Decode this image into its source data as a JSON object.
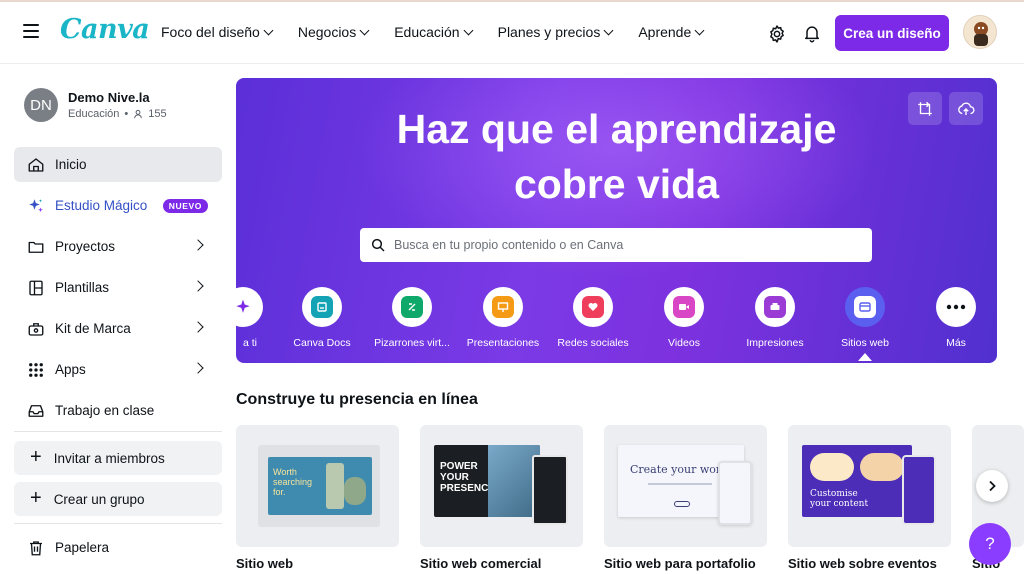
{
  "header": {
    "logo": "Canva",
    "nav": [
      {
        "label": "Foco del diseño"
      },
      {
        "label": "Negocios"
      },
      {
        "label": "Educación"
      },
      {
        "label": "Planes y precios"
      },
      {
        "label": "Aprende"
      }
    ],
    "create_label": "Crea un diseño",
    "icons": {
      "menu": "hamburger-menu-icon",
      "settings": "gear-icon",
      "notifications": "bell-icon"
    }
  },
  "sidebar": {
    "profile": {
      "initials": "DN",
      "name": "Demo Nive.la",
      "role": "Educación",
      "members": "155"
    },
    "items": [
      {
        "label": "Inicio",
        "icon": "home-icon"
      },
      {
        "label": "Estudio Mágico",
        "icon": "sparkle-icon",
        "badge": "NUEVO"
      },
      {
        "label": "Proyectos",
        "icon": "folder-icon"
      },
      {
        "label": "Plantillas",
        "icon": "template-icon"
      },
      {
        "label": "Kit de Marca",
        "icon": "brand-kit-icon"
      },
      {
        "label": "Apps",
        "icon": "apps-grid-icon"
      },
      {
        "label": "Trabajo en clase",
        "icon": "inbox-icon"
      }
    ],
    "invite_label": "Invitar a miembros",
    "group_label": "Crear un grupo",
    "trash_label": "Papelera"
  },
  "hero": {
    "title_line1": "Haz que el aprendizaje",
    "title_line2": "cobre vida",
    "search_placeholder": "Busca en tu propio contenido o en Canva",
    "categories": [
      {
        "label": "a ti"
      },
      {
        "label": "Canva Docs",
        "color": "#13a3b5"
      },
      {
        "label": "Pizarrones virt...",
        "color": "#0fa86b"
      },
      {
        "label": "Presentaciones",
        "color": "#f59a14"
      },
      {
        "label": "Redes sociales",
        "color": "#ef3e5c"
      },
      {
        "label": "Videos",
        "color": "#d946c5"
      },
      {
        "label": "Impresiones",
        "color": "#9b3bd6"
      },
      {
        "label": "Sitios web",
        "color": "#5b5ff0"
      },
      {
        "label": "Más"
      }
    ]
  },
  "section": {
    "title": "Construye tu presencia en línea",
    "cards": [
      {
        "label": "Sitio web",
        "thumb_text": "Worth searching for."
      },
      {
        "label": "Sitio web comercial",
        "thumb_text": "POWER YOUR PRESENCE"
      },
      {
        "label": "Sitio web para portafolio",
        "thumb_text": "Create your world"
      },
      {
        "label": "Sitio web sobre eventos",
        "thumb_text": "Customise your content"
      },
      {
        "label": "Sitio"
      }
    ]
  },
  "help_label": "?"
}
